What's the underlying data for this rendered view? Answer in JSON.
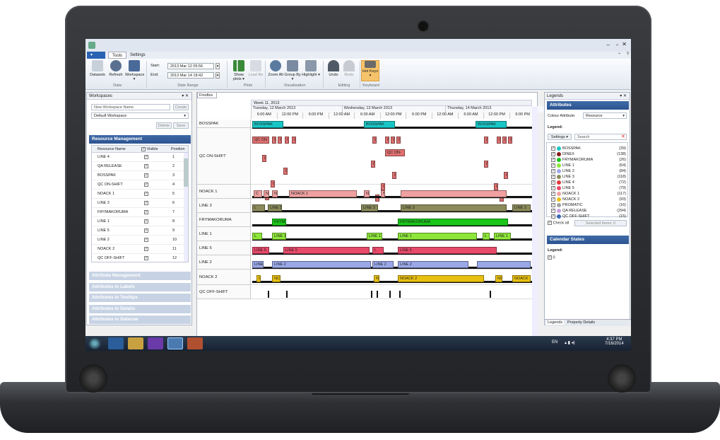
{
  "app": {
    "tabs": [
      "Tools",
      "Settings"
    ]
  },
  "ribbon": {
    "buttons": [
      {
        "label": "Datasets"
      },
      {
        "label": "Refresh"
      },
      {
        "label": "Workspace ▾"
      },
      {
        "label": "Show plots ▾"
      },
      {
        "label": "Load file"
      },
      {
        "label": "Zoom All"
      },
      {
        "label": "Group By ▾"
      },
      {
        "label": "Highlight ▾"
      },
      {
        "label": "Undo"
      },
      {
        "label": "Redo"
      },
      {
        "label": "Hot Keys ▾"
      }
    ],
    "start_label": "Start:",
    "start_value": "2013 Mar 12 05:56",
    "end_label": "End:",
    "end_value": "2013 Mar 14 18:42",
    "groups": [
      "Data",
      "Date Range",
      "Plots",
      "Visualization",
      "Editing",
      "Keyboard"
    ]
  },
  "workspaces": {
    "title": "Workspaces",
    "name_placeholder": "New Workspace Name",
    "create": "Create",
    "selected": "Default Workspace",
    "delete": "Delete",
    "save": "Save"
  },
  "resource_management": {
    "title": "Resource Management",
    "columns": [
      "Resource Name",
      "Visible",
      "Position"
    ],
    "rows": [
      {
        "name": "LINE 4",
        "pos": "1"
      },
      {
        "name": "QA RELEASE",
        "pos": "2"
      },
      {
        "name": "BOSSPAK",
        "pos": "3"
      },
      {
        "name": "QC ON-SHIFT",
        "pos": "4"
      },
      {
        "name": "NOACK 1",
        "pos": "5"
      },
      {
        "name": "LINE 3",
        "pos": "6"
      },
      {
        "name": "FRYMAKORUMA",
        "pos": "7"
      },
      {
        "name": "LINE 1",
        "pos": "8"
      },
      {
        "name": "LINE 5",
        "pos": "9"
      },
      {
        "name": "LINE 2",
        "pos": "10"
      },
      {
        "name": "NOACK 2",
        "pos": "11"
      },
      {
        "name": "QC OFF-SHIFT",
        "pos": "12"
      }
    ]
  },
  "collapsed_sections": [
    "Attribute Management",
    "Attributes in Labels",
    "Attributes in Tooltips",
    "Attributes in Details",
    "Attributes in Datarow"
  ],
  "gantt": {
    "tab": "Finoflex",
    "week": "Week 11, 2013",
    "days": [
      "Tuesday, 12 March 2013",
      "Wednesday, 13 March 2013",
      "Thursday, 14 March 2013"
    ],
    "hours": [
      "6:00 AM",
      "12:00 PM",
      "6:00 PM",
      "12:00 AM",
      "6:00 AM",
      "12:00 PM",
      "6:00 PM",
      "12:00 AM",
      "6:00 AM",
      "12:00 PM",
      "6:00 PM"
    ],
    "resources": [
      "BOSSPAK",
      "QC ON-SHIFT",
      "NOACK 1",
      "LINE 3",
      "FRYMAKORUMA",
      "LINE 1",
      "LINE 5",
      "LINE 2",
      "NOACK 2",
      "QC OFF-SHIFT"
    ],
    "bar_labels": {
      "bosspak": "BOSSPAK",
      "qcon": "QC ON",
      "qcon2": "QC ON-",
      "c": "C",
      "n": "N",
      "noack1": "NOACK 1",
      "line3": "LINE 3",
      "frym": "FRYM",
      "frymakoruma": "FRYMAKORUMA",
      "line1": "LINE 1",
      "l": "L",
      "line5": "LINE 5",
      "line2": "LINE 2",
      "noack2": "NOACK 2",
      "nc": "NC",
      "noack": "NOACK"
    }
  },
  "legends": {
    "title": "Legends",
    "attributes": "Attributes",
    "colour_attribute_label": "Colour Attribute:",
    "colour_attribute": "Resource",
    "legend_label": "Legend:",
    "settings": "Settings ▾",
    "search_placeholder": "Search",
    "items": [
      {
        "name": "BOSSPAK",
        "count": "(39)",
        "color": "#19c6c6"
      },
      {
        "name": "DINEX",
        "count": "(138)",
        "color": "#8a1a1a"
      },
      {
        "name": "FRYMAKORUMA",
        "count": "(26)",
        "color": "#19c619"
      },
      {
        "name": "LINE 1",
        "count": "(64)",
        "color": "#8ee63a"
      },
      {
        "name": "LINE 2",
        "count": "(84)",
        "color": "#9aa8e8"
      },
      {
        "name": "LINE 3",
        "count": "(118)",
        "color": "#8a8a5a"
      },
      {
        "name": "LINE 4",
        "count": "(72)",
        "color": "#e03a3a"
      },
      {
        "name": "LINE 5",
        "count": "(79)",
        "color": "#e84a6a"
      },
      {
        "name": "NOACK 1",
        "count": "(117)",
        "color": "#f0a0a0"
      },
      {
        "name": "NOACK 2",
        "count": "(93)",
        "color": "#e8c010"
      },
      {
        "name": "PROMATIC",
        "count": "(16)",
        "color": "#a0a0a0"
      },
      {
        "name": "QA RELEASE",
        "count": "(294)",
        "color": "#c8a0e0"
      },
      {
        "name": "QC OFF-SHIFT",
        "count": "(15)",
        "color": "#3a6ab4"
      }
    ],
    "check_all": "Check all",
    "selected_items": "Selected Items: 0",
    "calendar_states": "Calendar States",
    "cal_legend": "Legend:",
    "cal_item": "0",
    "bottom_tabs": [
      "Legends",
      "Property Details"
    ]
  },
  "taskbar": {
    "lang": "EN",
    "time": "4:37 PM",
    "date": "7/16/2014"
  }
}
